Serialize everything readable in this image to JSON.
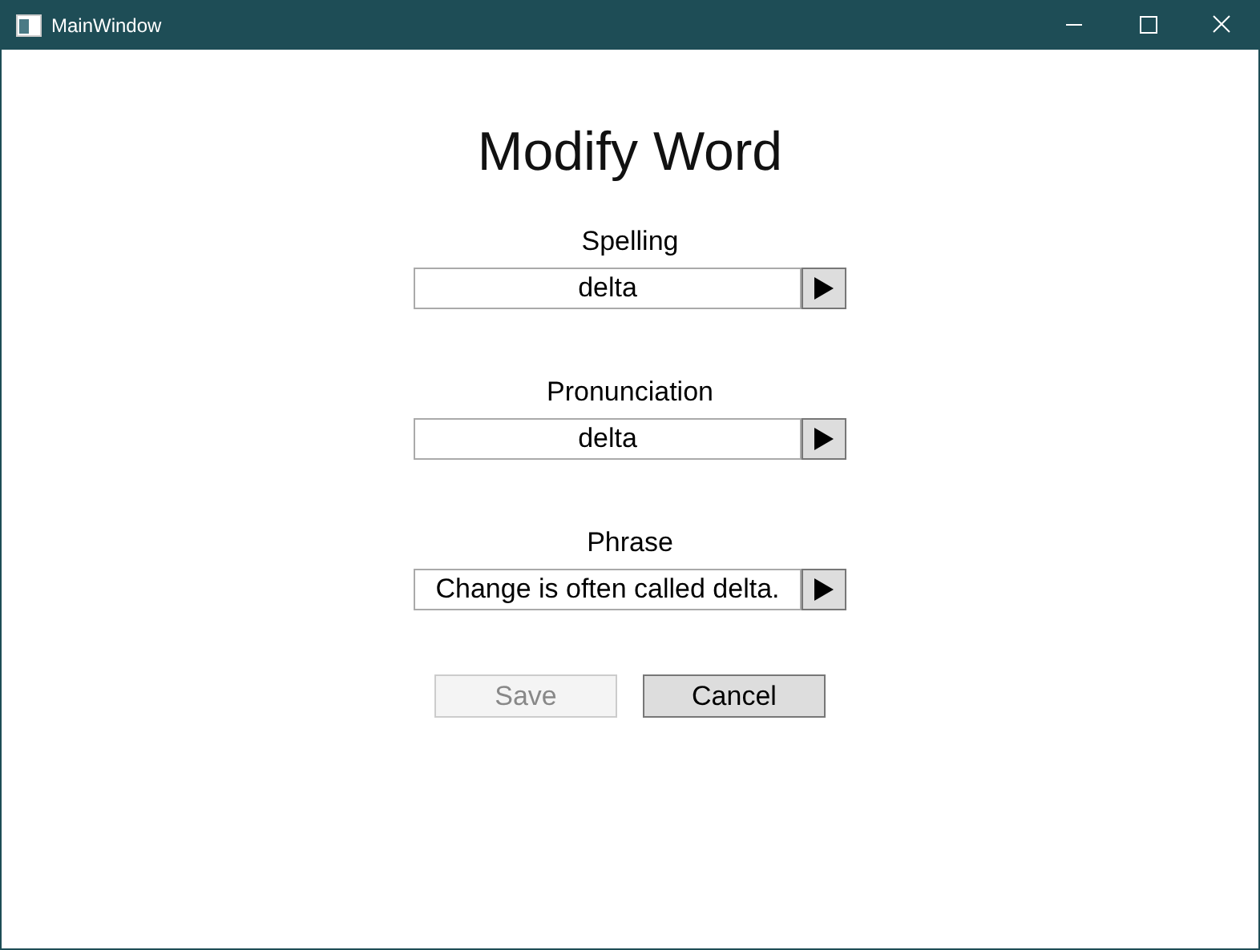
{
  "window": {
    "title": "MainWindow"
  },
  "heading": "Modify Word",
  "fields": [
    {
      "label": "Spelling",
      "value": "delta"
    },
    {
      "label": "Pronunciation",
      "value": "delta"
    },
    {
      "label": "Phrase",
      "value": "Change is often called delta."
    }
  ],
  "buttons": [
    {
      "label": "Save",
      "disabled": true
    },
    {
      "label": "Cancel",
      "disabled": false
    }
  ]
}
